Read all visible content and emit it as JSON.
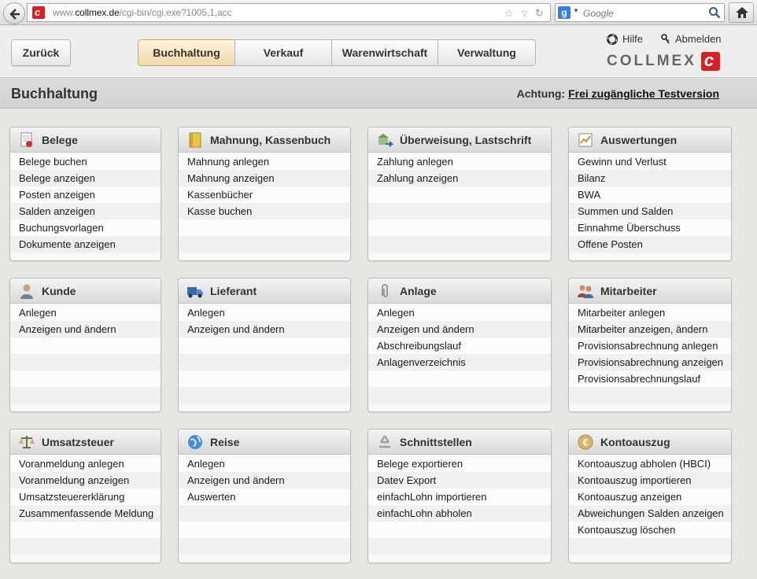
{
  "browser": {
    "url_prefix": "www.",
    "url_domain": "collmex.de",
    "url_path": "/cgi-bin/cgi.exe?1005,1,acc",
    "search_placeholder": "Google",
    "favicon_letter": "c",
    "search_engine_letter": "g"
  },
  "header": {
    "back_label": "Zurück",
    "tabs": [
      {
        "label": "Buchhaltung",
        "active": true
      },
      {
        "label": "Verkauf",
        "active": false
      },
      {
        "label": "Warenwirtschaft",
        "active": false
      },
      {
        "label": "Verwaltung",
        "active": false
      }
    ],
    "help_label": "Hilfe",
    "logout_label": "Abmelden",
    "logo_text": "COLLMEX",
    "logo_letter": "c"
  },
  "titlebar": {
    "title": "Buchhaltung",
    "notice_label": "Achtung:",
    "notice_link": "Frei zugängliche Testversion"
  },
  "colors": {
    "accent": "#d42027",
    "active_tab": "#f0d9a7"
  },
  "cards": [
    {
      "title": "Belege",
      "icon": "document-stamp-icon",
      "items": [
        "Belege buchen",
        "Belege anzeigen",
        "Posten anzeigen",
        "Salden anzeigen",
        "Buchungsvorlagen",
        "Dokumente anzeigen"
      ]
    },
    {
      "title": "Mahnung, Kassenbuch",
      "icon": "notebook-icon",
      "items": [
        "Mahnung anlegen",
        "Mahnung anzeigen",
        "Kassenbücher",
        "Kasse buchen"
      ]
    },
    {
      "title": "Überweisung, Lastschrift",
      "icon": "bank-transfer-icon",
      "items": [
        "Zahlung anlegen",
        "Zahlung anzeigen"
      ]
    },
    {
      "title": "Auswertungen",
      "icon": "chart-report-icon",
      "items": [
        "Gewinn und Verlust",
        "Bilanz",
        "BWA",
        "Summen und Salden",
        "Einnahme Überschuss",
        "Offene Posten"
      ]
    },
    {
      "title": "Kunde",
      "icon": "customer-icon",
      "items": [
        "Anlegen",
        "Anzeigen und ändern"
      ]
    },
    {
      "title": "Lieferant",
      "icon": "truck-icon",
      "items": [
        "Anlegen",
        "Anzeigen und ändern"
      ]
    },
    {
      "title": "Anlage",
      "icon": "paperclip-icon",
      "items": [
        "Anlegen",
        "Anzeigen und ändern",
        "Abschreibungslauf",
        "Anlagenverzeichnis"
      ]
    },
    {
      "title": "Mitarbeiter",
      "icon": "employees-icon",
      "items": [
        "Mitarbeiter anlegen",
        "Mitarbeiter anzeigen, ändern",
        "Provisionsabrechnung anlegen",
        "Provisionsabrechnung anzeigen",
        "Provisionsabrechnungslauf"
      ]
    },
    {
      "title": "Umsatzsteuer",
      "icon": "scales-icon",
      "items": [
        "Voranmeldung anlegen",
        "Voranmeldung anzeigen",
        "Umsatzsteuererklärung",
        "Zusammenfassende Meldung"
      ]
    },
    {
      "title": "Reise",
      "icon": "globe-icon",
      "items": [
        "Anlegen",
        "Anzeigen und ändern",
        "Auswerten"
      ]
    },
    {
      "title": "Schnittstellen",
      "icon": "recycle-icon",
      "items": [
        "Belege exportieren",
        "Datev Export",
        "einfachLohn importieren",
        "einfachLohn abholen"
      ]
    },
    {
      "title": "Kontoauszug",
      "icon": "euro-coin-icon",
      "items": [
        "Kontoauszug abholen (HBCI)",
        "Kontoauszug importieren",
        "Kontoauszug anzeigen",
        "Abweichungen Salden anzeigen",
        "Kontoauszug löschen"
      ]
    }
  ]
}
